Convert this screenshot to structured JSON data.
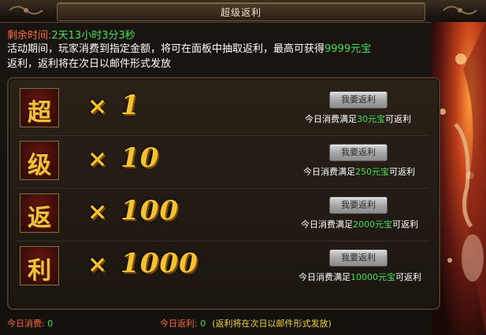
{
  "window": {
    "title": "超级返利"
  },
  "countdown": {
    "label": "剩余时间:",
    "value": "2天13小时3分3秒"
  },
  "description": {
    "line1_prefix": "活动期间，玩家消费到指定金额，将可在面板中抽取返利，最高可获得",
    "line1_highlight": "9999元宝",
    "line2": "返利，返利将在次日以邮件形式发放"
  },
  "rebate_rows": [
    {
      "char": "超",
      "multiplier": "1",
      "button": "我要返利",
      "cond_prefix": "今日消费满足",
      "cond_amount": "30元宝",
      "cond_suffix": "可返利"
    },
    {
      "char": "级",
      "multiplier": "10",
      "button": "我要返利",
      "cond_prefix": "今日消费满足",
      "cond_amount": "250元宝",
      "cond_suffix": "可返利"
    },
    {
      "char": "返",
      "multiplier": "100",
      "button": "我要返利",
      "cond_prefix": "今日消费满足",
      "cond_amount": "2000元宝",
      "cond_suffix": "可返利"
    },
    {
      "char": "利",
      "multiplier": "1000",
      "button": "我要返利",
      "cond_prefix": "今日消费满足",
      "cond_amount": "10000元宝",
      "cond_suffix": "可返利"
    }
  ],
  "multiplier_symbol": "×",
  "footer": {
    "today_spend_label": "今日消费:",
    "today_spend_value": "0",
    "today_rebate_label": "今日返利:",
    "today_rebate_value": "0",
    "note": "(返利将在次日以邮件形式发放)"
  },
  "colors": {
    "label_orange": "#ff6a3c",
    "value_green": "#45e05a",
    "gold": "#f5c233",
    "note_yellow": "#f2d53a"
  },
  "icons": {
    "title_ornament": "ornament-icon",
    "character_art": "character-illustration"
  }
}
